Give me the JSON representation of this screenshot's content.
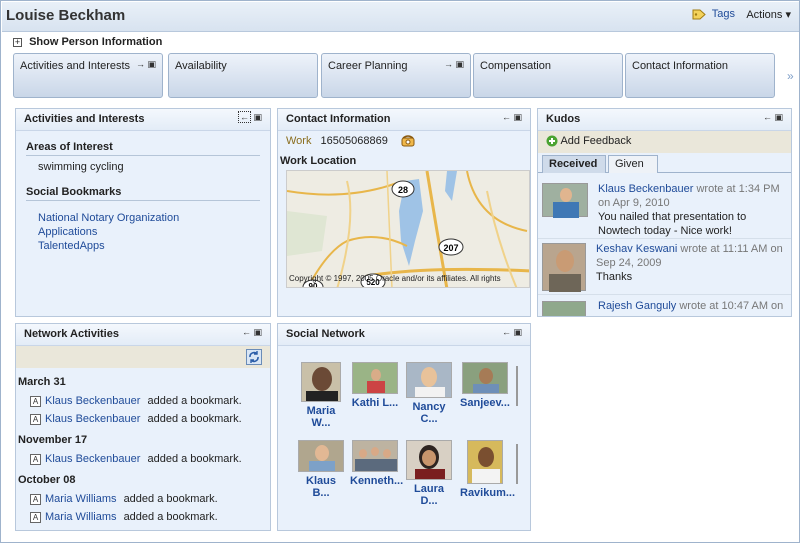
{
  "header": {
    "title": "Louise Beckham",
    "tags_label": "Tags",
    "actions_label": "Actions ▾"
  },
  "person_toggle": {
    "expand_glyph": "+",
    "label": "Show Person Information"
  },
  "tabs": [
    {
      "label": "Activities and Interests",
      "has_controls": true
    },
    {
      "label": "Availability",
      "has_controls": false
    },
    {
      "label": "Career Planning",
      "has_controls": true
    },
    {
      "label": "Compensation",
      "has_controls": false
    },
    {
      "label": "Contact Information",
      "has_controls": false
    }
  ],
  "tab_more_glyph": "»",
  "activities": {
    "title": "Activities and Interests",
    "areas_heading": "Areas of Interest",
    "areas": "swimming cycling",
    "bookmarks_heading": "Social Bookmarks",
    "bookmarks": [
      "National Notary Organization",
      "Applications",
      "TalentedApps"
    ]
  },
  "contact": {
    "title": "Contact Information",
    "work_label": "Work",
    "work_phone": "16505068869",
    "location_heading": "Work Location",
    "map": {
      "copyright": "Copyright © 1997, 2005 Oracle and/or its affiliates. All rights",
      "routes": [
        "28",
        "207",
        "520",
        "90"
      ]
    }
  },
  "kudos": {
    "title": "Kudos",
    "add_label": "Add Feedback",
    "tabs": [
      "Received",
      "Given"
    ],
    "items": [
      {
        "author": "Klaus Beckenbauer",
        "when": "wrote at 1:34 PM on Apr 9, 2010",
        "text": "You nailed that presentation to Nowtech today - Nice work!"
      },
      {
        "author": "Keshav Keswani",
        "when": "wrote at 11:11 AM on Sep 24, 2009",
        "text": "Thanks"
      },
      {
        "author": "Rajesh Ganguly",
        "when": "wrote at 10:47 AM on",
        "text": ""
      }
    ]
  },
  "network": {
    "title": "Network Activities",
    "groups": [
      {
        "date": "March 31",
        "rows": [
          {
            "who": "Klaus Beckenbauer",
            "action": "added a bookmark."
          },
          {
            "who": "Klaus Beckenbauer",
            "action": "added a bookmark."
          }
        ]
      },
      {
        "date": "November 17",
        "rows": [
          {
            "who": "Klaus Beckenbauer",
            "action": "added a bookmark."
          }
        ]
      },
      {
        "date": "October 08",
        "rows": [
          {
            "who": "Maria Williams",
            "action": "added a bookmark."
          },
          {
            "who": "Maria Williams",
            "action": "added a bookmark."
          }
        ]
      }
    ]
  },
  "social": {
    "title": "Social Network",
    "people": [
      {
        "name1": "Maria",
        "name2": "W..."
      },
      {
        "name1": "Kathi L...",
        "name2": ""
      },
      {
        "name1": "Nancy",
        "name2": "C..."
      },
      {
        "name1": "Sanjeev...",
        "name2": ""
      },
      {
        "name1": "Klaus B...",
        "name2": ""
      },
      {
        "name1": "Kenneth...",
        "name2": ""
      },
      {
        "name1": "Laura",
        "name2": "D..."
      },
      {
        "name1": "Ravikum...",
        "name2": ""
      }
    ]
  },
  "controls": {
    "move_glyph": "←",
    "max_glyph": "▣",
    "arrow_glyph": "→"
  },
  "colors": {
    "accent": "#1f4b99",
    "panel_bg": "#e9f1fb",
    "border": "#b8c8dc"
  }
}
